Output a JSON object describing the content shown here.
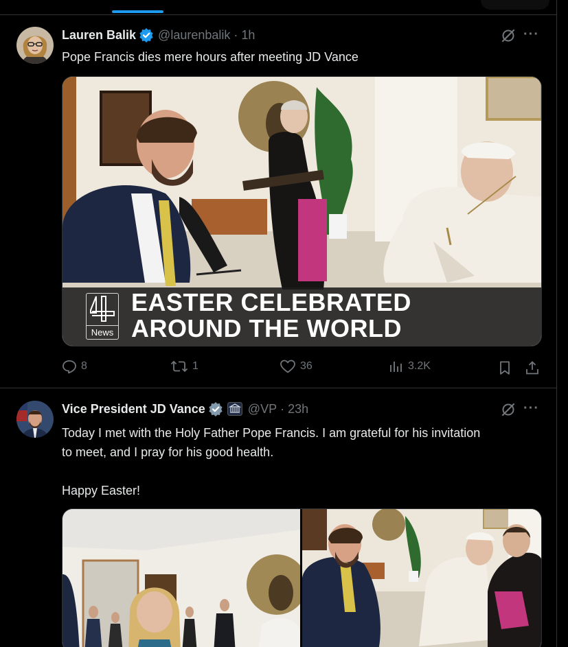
{
  "tweets": [
    {
      "name": "Lauren Balik",
      "handle": "@laurenbalik",
      "time": "· 1h",
      "text": "Pope Francis dies mere hours after meeting JD Vance",
      "media": {
        "logo_text": "News",
        "headline_line1": "EASTER CELEBRATED",
        "headline_line2": "AROUND THE WORLD"
      },
      "stats": {
        "replies": "8",
        "reposts": "1",
        "likes": "36",
        "views": "3.2K"
      }
    },
    {
      "name": "Vice President JD Vance",
      "handle": "@VP",
      "time": "· 23h",
      "text_line1": "Today I met with the Holy Father Pope Francis. I am grateful for his invitation",
      "text_line2": "to meet, and I pray for his good health.",
      "text_line3": "Happy Easter!"
    }
  ],
  "colors": {
    "accent": "#1d9bf0",
    "muted": "#71767b",
    "text": "#e7e9ea",
    "border": "#2f3336",
    "gov_badge": "#829aab"
  },
  "icons": [
    "verified-badge-icon",
    "government-badge-icon",
    "grok-icon",
    "more-icon",
    "reply-icon",
    "repost-icon",
    "like-icon",
    "views-icon",
    "bookmark-icon",
    "share-icon"
  ]
}
